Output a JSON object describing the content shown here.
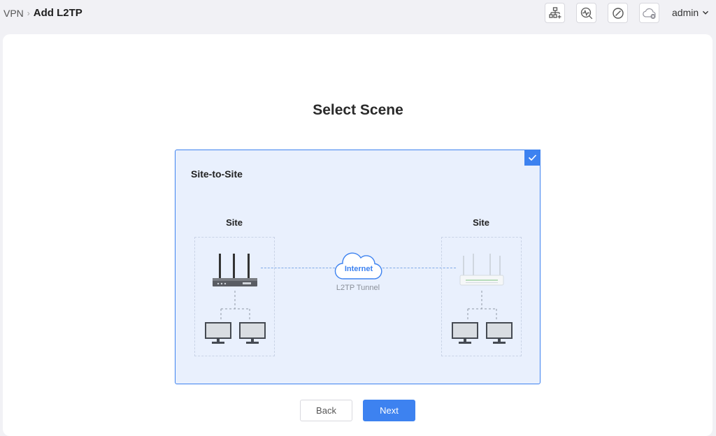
{
  "breadcrumb": {
    "parent": "VPN",
    "separator": "›",
    "current": "Add L2TP"
  },
  "header": {
    "icons": [
      "add-topology-icon",
      "diagnostics-icon",
      "block-icon",
      "cloud-offline-icon"
    ],
    "user": "admin"
  },
  "page": {
    "title": "Select Scene"
  },
  "scene": {
    "title": "Site-to-Site",
    "selected": true,
    "left_site_label": "Site",
    "right_site_label": "Site",
    "cloud_label": "Internet",
    "tunnel_label": "L2TP Tunnel"
  },
  "buttons": {
    "back": "Back",
    "next": "Next"
  },
  "colors": {
    "accent": "#3d82f0",
    "scene_bg": "#e9f0fd",
    "page_bg": "#f1f1f5"
  }
}
